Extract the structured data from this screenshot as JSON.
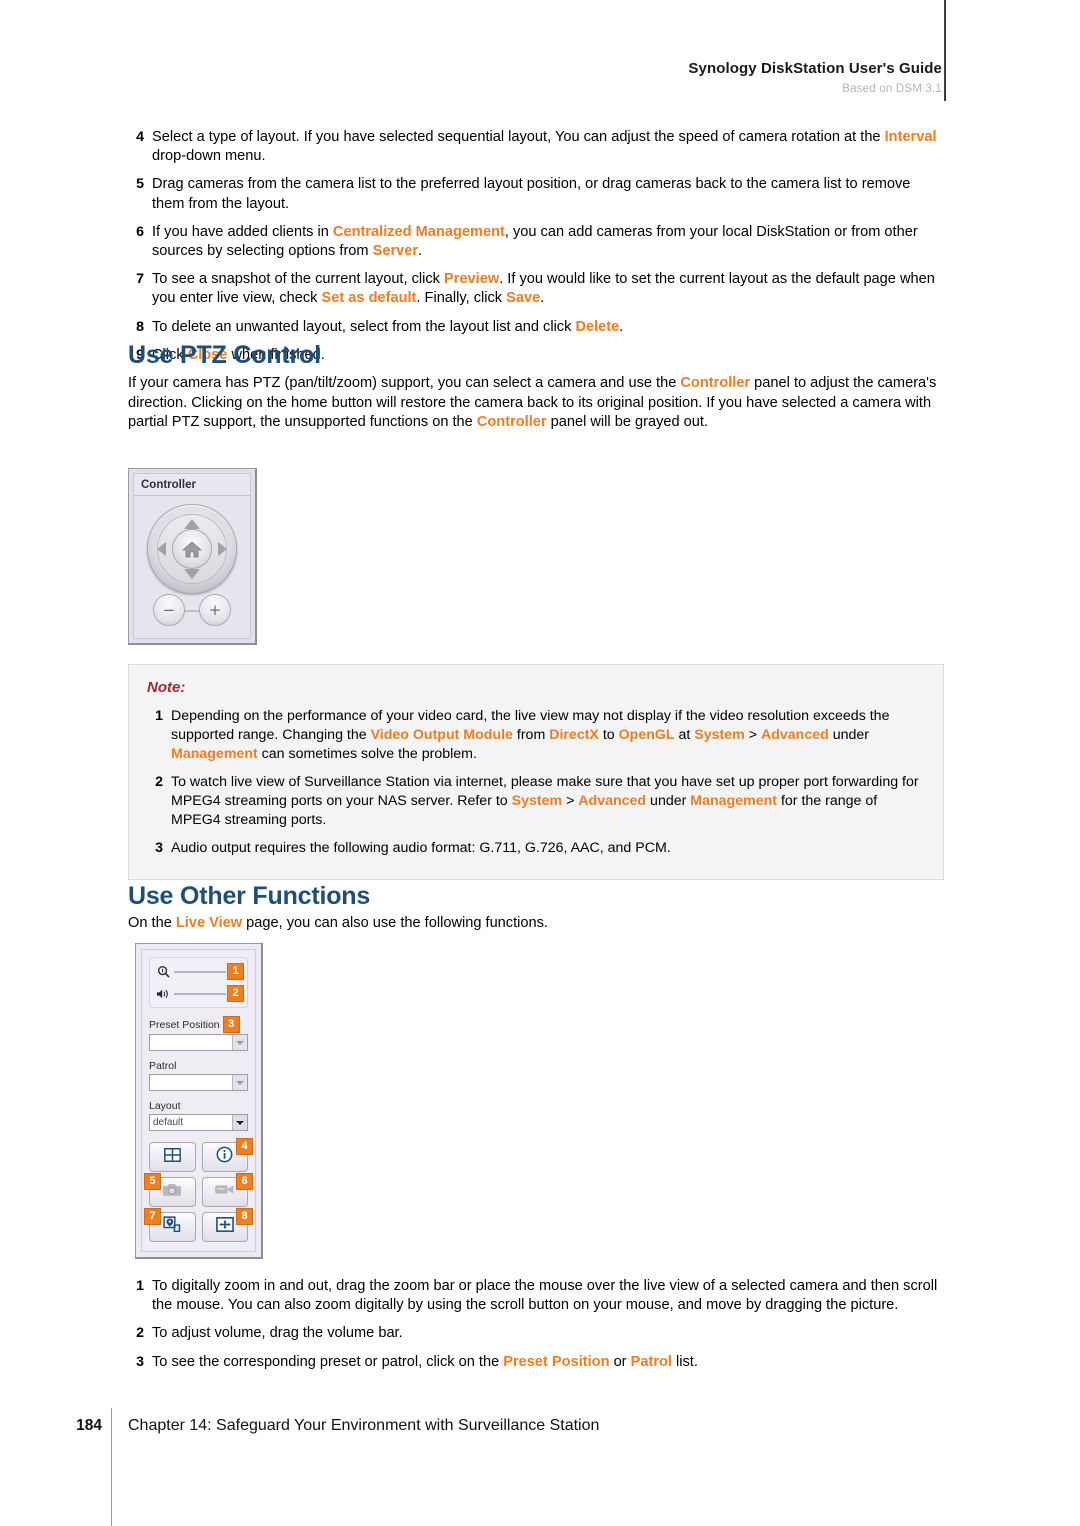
{
  "header": {
    "title": "Synology DiskStation User's Guide",
    "subtitle": "Based on DSM 3.1"
  },
  "top_steps": [
    {
      "num": "4",
      "parts": [
        {
          "t": "Select a type of layout. If you have selected sequential layout, You can adjust the speed of camera rotation at the ",
          "k": false
        },
        {
          "t": "Interval",
          "k": true
        },
        {
          "t": " drop-down menu.",
          "k": false
        }
      ]
    },
    {
      "num": "5",
      "parts": [
        {
          "t": "Drag cameras from the camera list to the preferred layout position, or drag cameras back to the camera list to remove them from the layout.",
          "k": false
        }
      ]
    },
    {
      "num": "6",
      "parts": [
        {
          "t": "If you have added clients in ",
          "k": false
        },
        {
          "t": "Centralized Management",
          "k": true
        },
        {
          "t": ", you can add cameras from your local DiskStation or from other sources by selecting options from ",
          "k": false
        },
        {
          "t": "Server",
          "k": true
        },
        {
          "t": ".",
          "k": false
        }
      ]
    },
    {
      "num": "7",
      "parts": [
        {
          "t": "To see a snapshot of the current layout, click ",
          "k": false
        },
        {
          "t": "Preview",
          "k": true
        },
        {
          "t": ". If you would like to set the current layout as the default page when you enter live view, check ",
          "k": false
        },
        {
          "t": "Set as default",
          "k": true
        },
        {
          "t": ". Finally, click ",
          "k": false
        },
        {
          "t": "Save",
          "k": true
        },
        {
          "t": ".",
          "k": false
        }
      ]
    },
    {
      "num": "8",
      "parts": [
        {
          "t": "To delete an unwanted layout, select from the layout list and click ",
          "k": false
        },
        {
          "t": "Delete",
          "k": true
        },
        {
          "t": ".",
          "k": false
        }
      ]
    },
    {
      "num": "9",
      "parts": [
        {
          "t": "Click ",
          "k": false
        },
        {
          "t": "Close",
          "k": true
        },
        {
          "t": " when finished.",
          "k": false
        }
      ]
    }
  ],
  "ptz": {
    "heading": "Use PTZ Control",
    "paragraph_parts": [
      {
        "t": "If your camera has PTZ (pan/tilt/zoom) support, you can select a camera and use the ",
        "k": false
      },
      {
        "t": "Controller",
        "k": true
      },
      {
        "t": " panel to adjust the camera's direction. Clicking on the home button will restore the camera back to its original position. If you have selected a camera with partial PTZ support, the unsupported functions on the ",
        "k": false
      },
      {
        "t": "Controller",
        "k": true
      },
      {
        "t": " panel will be grayed out.",
        "k": false
      }
    ]
  },
  "controller_panel": {
    "title": "Controller",
    "up_icon": "arrow-up-icon",
    "down_icon": "arrow-down-icon",
    "left_icon": "arrow-left-icon",
    "right_icon": "arrow-right-icon",
    "home_icon": "home-icon",
    "zoom_out_label": "−",
    "zoom_in_label": "+"
  },
  "note": {
    "title": "Note:",
    "items": [
      {
        "num": "1",
        "parts": [
          {
            "t": "Depending on the performance of your video card, the live view may not display if the video resolution exceeds the supported range. Changing the ",
            "k": false
          },
          {
            "t": "Video Output Module",
            "k": true
          },
          {
            "t": " from ",
            "k": false
          },
          {
            "t": "DirectX",
            "k": true
          },
          {
            "t": " to ",
            "k": false
          },
          {
            "t": "OpenGL",
            "k": true
          },
          {
            "t": " at ",
            "k": false
          },
          {
            "t": "System",
            "k": true
          },
          {
            "t": " > ",
            "k": false
          },
          {
            "t": "Advanced",
            "k": true
          },
          {
            "t": " under ",
            "k": false
          },
          {
            "t": "Management",
            "k": true
          },
          {
            "t": " can sometimes solve the problem.",
            "k": false
          }
        ]
      },
      {
        "num": "2",
        "parts": [
          {
            "t": "To watch live view of Surveillance Station via internet, please make sure that you have set up proper port forwarding for MPEG4 streaming ports on your NAS server. Refer to ",
            "k": false
          },
          {
            "t": "System",
            "k": true
          },
          {
            "t": " > ",
            "k": false
          },
          {
            "t": "Advanced",
            "k": true
          },
          {
            "t": " under ",
            "k": false
          },
          {
            "t": "Management",
            "k": true
          },
          {
            "t": " for the range of MPEG4 streaming ports.",
            "k": false
          }
        ]
      },
      {
        "num": "3",
        "parts": [
          {
            "t": "Audio output requires the following audio format: G.711, G.726, AAC, and PCM.",
            "k": false
          }
        ]
      }
    ]
  },
  "other": {
    "heading": "Use Other Functions",
    "paragraph_parts": [
      {
        "t": "On the ",
        "k": false
      },
      {
        "t": "Live View",
        "k": true
      },
      {
        "t": " page, you can also use the following functions.",
        "k": false
      }
    ]
  },
  "functions_panel": {
    "zoom_slider": {
      "icon": "magnifier-icon",
      "badge": "1"
    },
    "volume_slider": {
      "icon": "speaker-icon",
      "badge": "2"
    },
    "preset_position": {
      "label": "Preset Position",
      "badge": "3",
      "value": "",
      "icon": "chevron-down-icon"
    },
    "patrol": {
      "label": "Patrol",
      "value": "",
      "icon": "chevron-down-icon"
    },
    "layout": {
      "label": "Layout",
      "value": "default",
      "icon": "chevron-down-icon"
    },
    "buttons": [
      {
        "name": "layout-grid-button",
        "icon": "grid-icon",
        "badge": "",
        "badge_side": "right"
      },
      {
        "name": "camera-info-button",
        "icon": "info-icon",
        "badge": "4",
        "badge_side": "right"
      },
      {
        "name": "snapshot-button",
        "icon": "camera-icon",
        "badge": "5",
        "badge_side": "left"
      },
      {
        "name": "record-button",
        "icon": "camcorder-icon",
        "badge": "6",
        "badge_side": "right"
      },
      {
        "name": "e-map-button",
        "icon": "emap-pin-icon",
        "badge": "7",
        "badge_side": "left"
      },
      {
        "name": "fullscreen-button",
        "icon": "fullscreen-icon",
        "badge": "8",
        "badge_side": "right"
      }
    ]
  },
  "bottom_steps": [
    {
      "num": "1",
      "parts": [
        {
          "t": "To digitally zoom in and out, drag the zoom bar or place the mouse over the live view of a selected camera and then scroll the mouse. You can also zoom digitally by using the scroll button on your mouse, and move by dragging the picture.",
          "k": false
        }
      ]
    },
    {
      "num": "2",
      "parts": [
        {
          "t": "To adjust volume, drag the volume bar.",
          "k": false
        }
      ]
    },
    {
      "num": "3",
      "parts": [
        {
          "t": "To see the corresponding preset or patrol, click on the ",
          "k": false
        },
        {
          "t": "Preset Position",
          "k": true
        },
        {
          "t": " or ",
          "k": false
        },
        {
          "t": "Patrol",
          "k": true
        },
        {
          "t": " list.",
          "k": false
        }
      ]
    }
  ],
  "footer": {
    "page_number": "184",
    "chapter": "Chapter 14: Safeguard Your Environment with Surveillance Station"
  },
  "colors": {
    "keyword": "#F07B20",
    "heading": "#1F4E79",
    "note_title": "#9E2A2B",
    "badge": "#F0801E"
  }
}
